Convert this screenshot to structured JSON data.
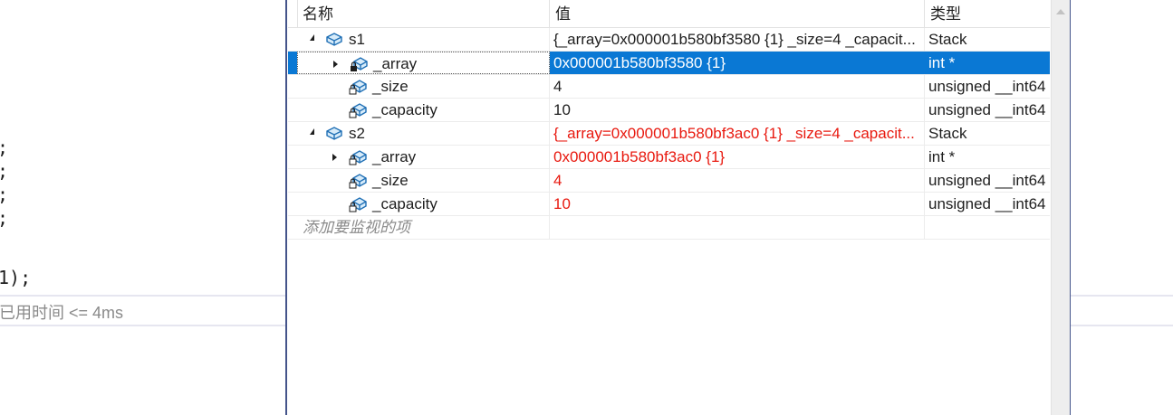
{
  "editor": {
    "code_lines": [
      ";",
      ";",
      ";",
      ";"
    ],
    "last_line_num": "1",
    "last_line_rest": ");",
    "perf_tip": "已用时间 <= 4ms"
  },
  "watch": {
    "columns": {
      "name": "名称",
      "value": "值",
      "type": "类型"
    },
    "rows": [
      {
        "name": "s1",
        "value": "{_array=0x000001b580bf3580 {1} _size=4 _capacit...",
        "type": "Stack"
      },
      {
        "name": "_array",
        "value": "0x000001b580bf3580 {1}",
        "type": "int *"
      },
      {
        "name": "_size",
        "value": "4",
        "type": "unsigned __int64"
      },
      {
        "name": "_capacity",
        "value": "10",
        "type": "unsigned __int64"
      },
      {
        "name": "s2",
        "value": "{_array=0x000001b580bf3ac0 {1} _size=4 _capacit...",
        "type": "Stack"
      },
      {
        "name": "_array",
        "value": "0x000001b580bf3ac0 {1}",
        "type": "int *"
      },
      {
        "name": "_size",
        "value": "4",
        "type": "unsigned __int64"
      },
      {
        "name": "_capacity",
        "value": "10",
        "type": "unsigned __int64"
      }
    ],
    "add_item": "添加要监视的项"
  },
  "colors": {
    "selection": "#0a78d4",
    "changed_value": "#e8190f",
    "window_border": "#44548a"
  }
}
